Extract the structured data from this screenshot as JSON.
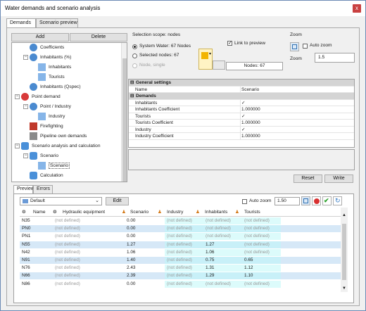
{
  "window": {
    "title": "Water demands and scenario analysis",
    "close": "x"
  },
  "main_tabs": [
    "Demands",
    "Scenario preview"
  ],
  "buttons": {
    "add": "Add",
    "delete": "Delete",
    "reset": "Reset",
    "write": "Write",
    "edit": "Edit"
  },
  "tree": [
    {
      "label": "Coefficients",
      "icon": "gear-water-icon",
      "indent": 2,
      "expander": ""
    },
    {
      "label": "Inhabitants (%)",
      "icon": "gear-water-icon",
      "indent": 2,
      "expander": "−"
    },
    {
      "label": "Inhabitants",
      "icon": "table-icon",
      "indent": 3,
      "expander": ""
    },
    {
      "label": "Tourists",
      "icon": "table-icon",
      "indent": 3,
      "expander": ""
    },
    {
      "label": "Inhabitants (Qspec)",
      "icon": "gear-water-icon",
      "indent": 2,
      "expander": ""
    },
    {
      "label": "Point demand",
      "icon": "point-demand-icon",
      "indent": 1,
      "expander": "−"
    },
    {
      "label": "Point / Industry",
      "icon": "gear-water-icon",
      "indent": 2,
      "expander": "−"
    },
    {
      "label": "Industry",
      "icon": "table-icon",
      "indent": 3,
      "expander": ""
    },
    {
      "label": "Firefighting",
      "icon": "fire-hydrant-icon",
      "indent": 2,
      "expander": ""
    },
    {
      "label": "Pipeline own demands",
      "icon": "pipe-icon",
      "indent": 2,
      "expander": ""
    },
    {
      "label": "Scenario analysis and calculation",
      "icon": "database-icon",
      "indent": 1,
      "expander": "−"
    },
    {
      "label": "Scenario",
      "icon": "database-icon",
      "indent": 2,
      "expander": "−"
    },
    {
      "label": "Scenario",
      "icon": "table-icon",
      "indent": 3,
      "expander": "",
      "selected": true
    },
    {
      "label": "Calculation",
      "icon": "database-icon",
      "indent": 2,
      "expander": ""
    }
  ],
  "selection": {
    "title": "Selection scope: nodes",
    "option_system": "System Water: 67 Nodes",
    "option_selected": "Selected nodes: 67",
    "option_single": "Node, single",
    "link_preview": "Link to preview",
    "nodes_count": "Nodes: 67"
  },
  "zoom": {
    "title": "Zoom",
    "auto_zoom": "Auto zoom",
    "label": "Zoom",
    "value": "1.5"
  },
  "properties": {
    "general_header": "General settings",
    "name_label": "Name",
    "name_value": "Scenario",
    "demands_header": "Demands",
    "rows": [
      {
        "name": "Inhabitants",
        "value": "✓"
      },
      {
        "name": "Inhabitants Coefficient",
        "value": "1.000000"
      },
      {
        "name": "Tourists",
        "value": "✓"
      },
      {
        "name": "Tourists Coefficient",
        "value": "1.000000"
      },
      {
        "name": "Industry",
        "value": "✓"
      },
      {
        "name": "Industry Coefficient",
        "value": "1.000000"
      }
    ]
  },
  "sub_tabs": [
    "Preview",
    "Errors"
  ],
  "preview": {
    "combo_value": "Default",
    "auto_zoom": "Auto zoom",
    "zoom_value": "1.50",
    "headers": [
      "Name",
      "Hydraulic equipment",
      "Scenario",
      "Industry",
      "Inhabitants",
      "Tourists"
    ],
    "rows": [
      [
        "N35",
        "(not defined)",
        "0.00",
        "(not defined)",
        "(not defined)",
        "(not defined)"
      ],
      [
        "PN0",
        "(not defined)",
        "0.00",
        "(not defined)",
        "(not defined)",
        "(not defined)"
      ],
      [
        "PN1",
        "(not defined)",
        "0.00",
        "(not defined)",
        "(not defined)",
        "(not defined)"
      ],
      [
        "N55",
        "(not defined)",
        "1.27",
        "(not defined)",
        "1.27",
        "(not defined)"
      ],
      [
        "N42",
        "(not defined)",
        "1.06",
        "(not defined)",
        "1.06",
        "(not defined)"
      ],
      [
        "N91",
        "(not defined)",
        "1.40",
        "(not defined)",
        "0.75",
        "0.65"
      ],
      [
        "N76",
        "(not defined)",
        "2.43",
        "(not defined)",
        "1.31",
        "1.12"
      ],
      [
        "N66",
        "(not defined)",
        "2.39",
        "(not defined)",
        "1.29",
        "1.10"
      ],
      [
        "N86",
        "(not defined)",
        "0.00",
        "(not defined)",
        "(not defined)",
        "(not defined)"
      ]
    ]
  }
}
